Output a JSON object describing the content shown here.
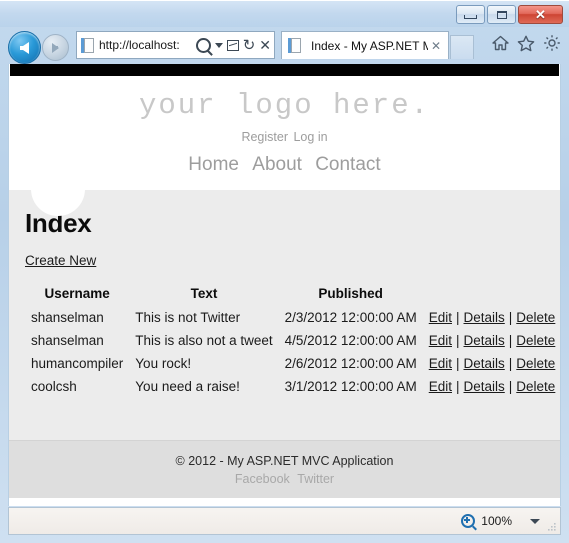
{
  "browser": {
    "window_controls": {
      "minimize": "–",
      "maximize": "□",
      "close": "✕"
    },
    "back_tooltip": "Back",
    "forward_tooltip": "Forward",
    "address_value": "http://localhost:",
    "address_placeholder": "http://localhost:",
    "address_icons": [
      "search-icon",
      "dropdown-caret-icon",
      "compatibility-view-icon",
      "refresh-icon",
      "stop-icon"
    ],
    "refresh_glyph": "↻",
    "stop_glyph": "✕",
    "tab": {
      "title": "Index - My ASP.NET M...",
      "close_glyph": "✕"
    },
    "toolbar_icons": [
      "home-icon",
      "favorites-star-icon",
      "settings-gear-icon"
    ],
    "status": {
      "zoom_level": "100%",
      "zoom_icon": "zoom-magnifier-icon"
    }
  },
  "site": {
    "logo_text": "your logo here.",
    "user_links": [
      {
        "label": "Register"
      },
      {
        "label": "Log in"
      }
    ],
    "nav_links": [
      {
        "label": "Home"
      },
      {
        "label": "About"
      },
      {
        "label": "Contact"
      }
    ]
  },
  "main": {
    "page_title": "Index",
    "create_new_label": "Create New",
    "table": {
      "columns": [
        "Username",
        "Text",
        "Published"
      ],
      "action_labels": [
        "Edit",
        "Details",
        "Delete"
      ],
      "separator": "|",
      "rows": [
        {
          "username": "shanselman",
          "text": "This is not Twitter",
          "published": "2/3/2012 12:00:00 AM"
        },
        {
          "username": "shanselman",
          "text": "This is also not a tweet",
          "published": "4/5/2012 12:00:00 AM"
        },
        {
          "username": "humancompiler",
          "text": "You rock!",
          "published": "2/6/2012 12:00:00 AM"
        },
        {
          "username": "coolcsh",
          "text": "You need a raise!",
          "published": "3/1/2012 12:00:00 AM"
        }
      ]
    }
  },
  "footer": {
    "copyright": "© 2012 - My ASP.NET MVC Application",
    "social_links": [
      {
        "label": "Facebook"
      },
      {
        "label": "Twitter"
      }
    ]
  },
  "colors": {
    "logo_gray": "#c8c8c8",
    "nav_gray": "#9d9d9d",
    "body_gray": "#ececec",
    "footer_gray": "#dedede",
    "black_bar": "#000000",
    "close_button_red": "#cd4433",
    "back_button_blue": "#2a9ad8"
  }
}
